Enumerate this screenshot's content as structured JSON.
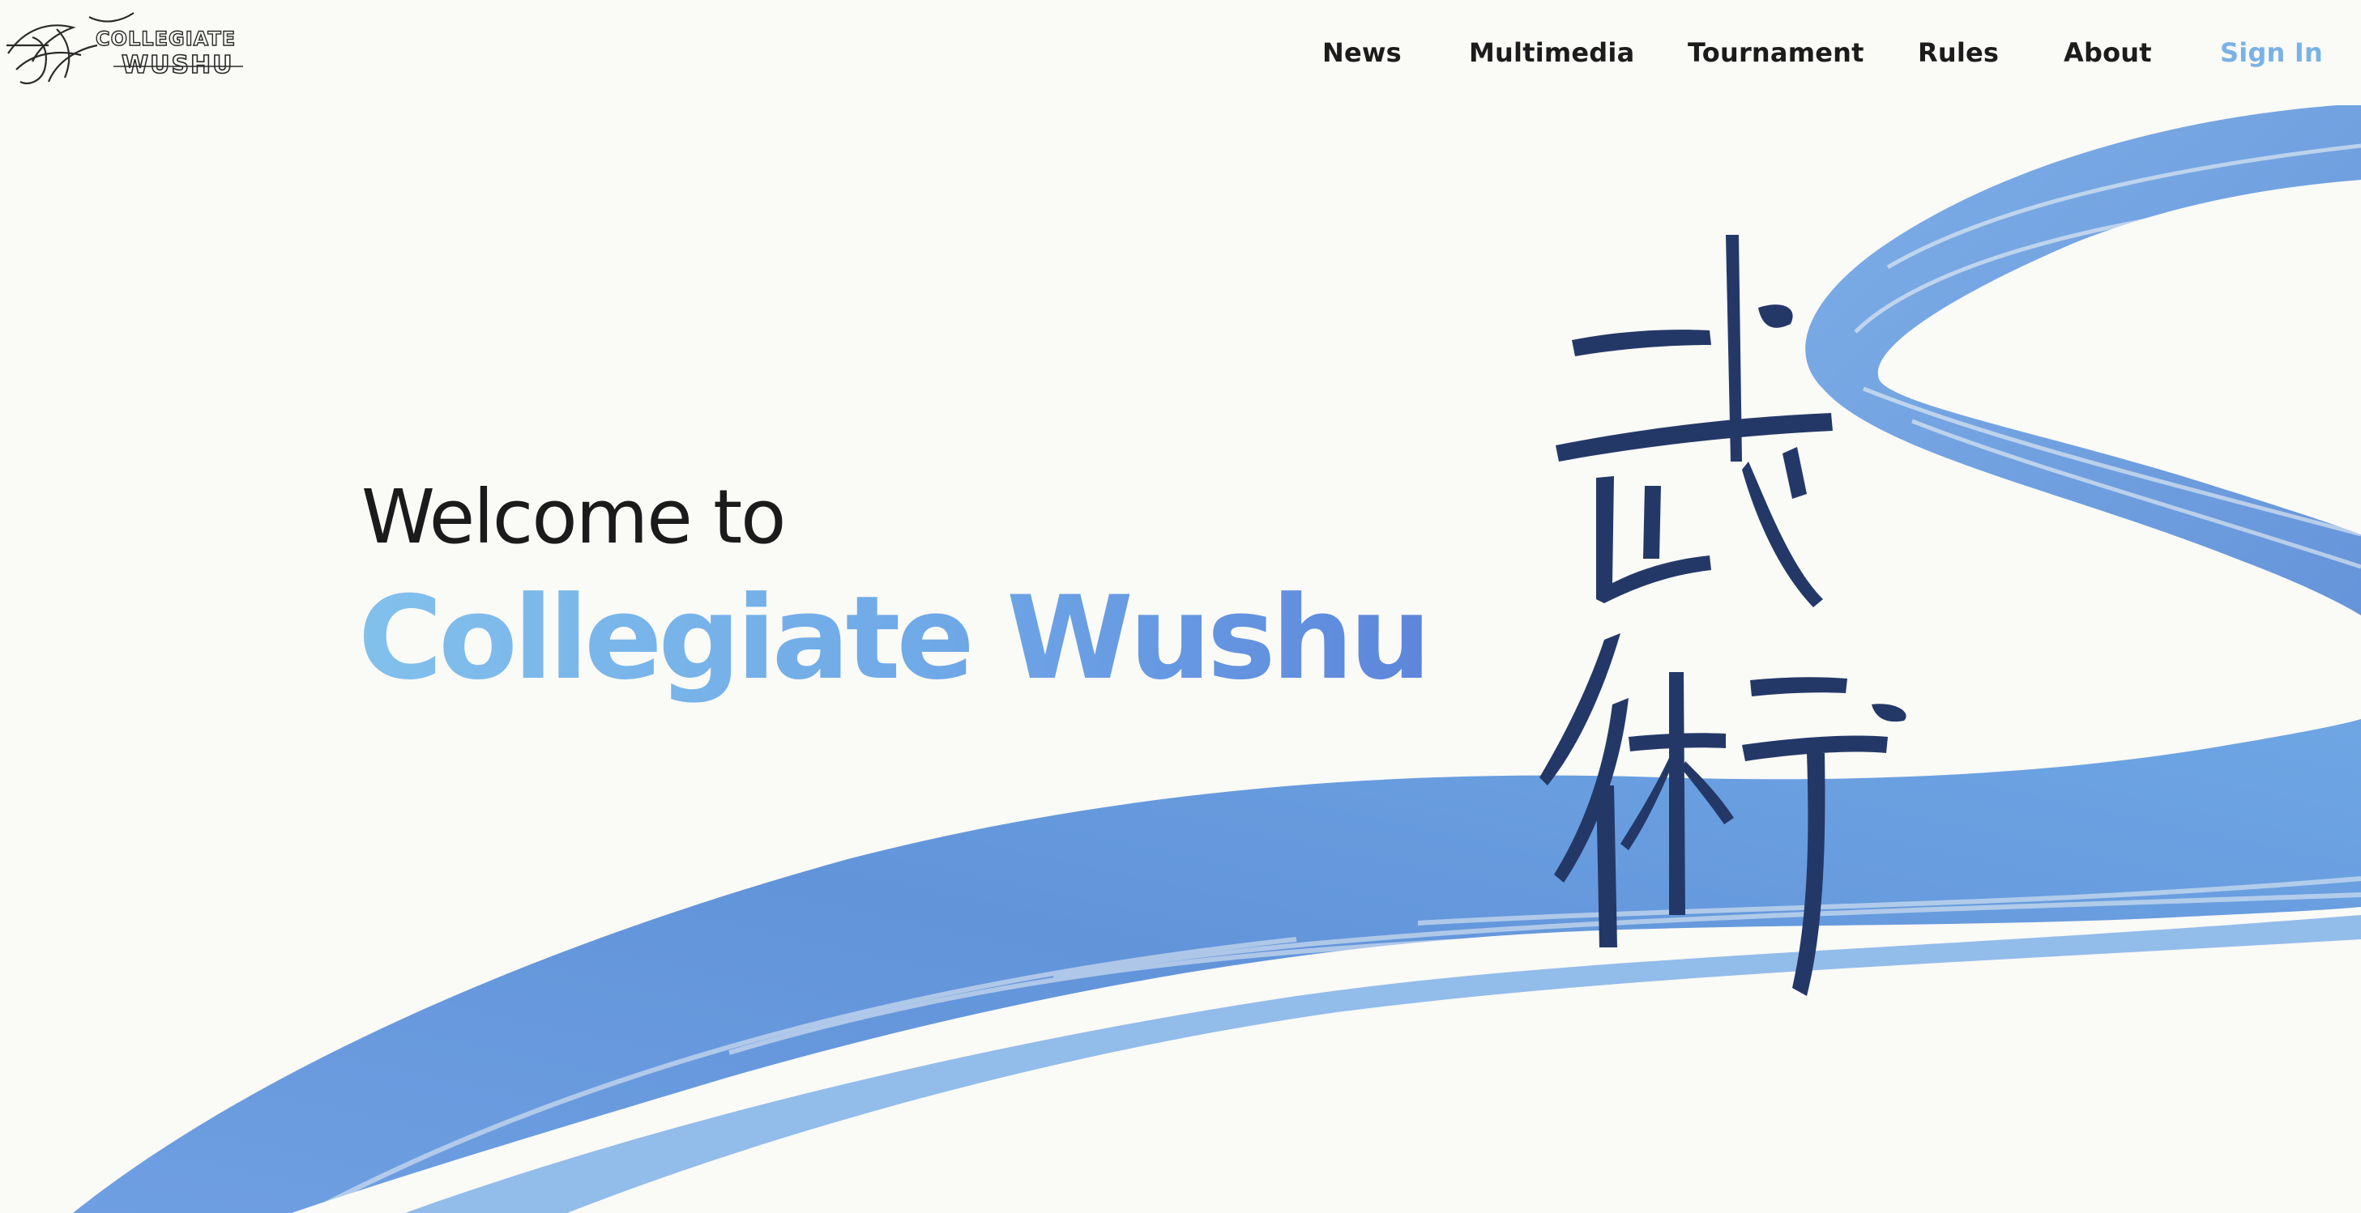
{
  "header": {
    "logo": {
      "line1": "COLLEGIATE",
      "line2": "WUSHU"
    },
    "nav": [
      {
        "label": "News"
      },
      {
        "label": "Multimedia"
      },
      {
        "label": "Tournament"
      },
      {
        "label": "Rules"
      },
      {
        "label": "About"
      },
      {
        "label": "Sign In"
      }
    ]
  },
  "hero": {
    "welcome": "Welcome to",
    "brand": "Collegiate Wushu",
    "calligraphy": "武術"
  },
  "colors": {
    "background": "#fafaf6",
    "brush_blue": "#6a9fe0",
    "brush_blue_dark": "#5c89d8",
    "ink_navy": "#243868",
    "sign_in": "#7ab2e6",
    "brand_gradient_start": "#82c0ec",
    "brand_gradient_end": "#5d86db"
  }
}
